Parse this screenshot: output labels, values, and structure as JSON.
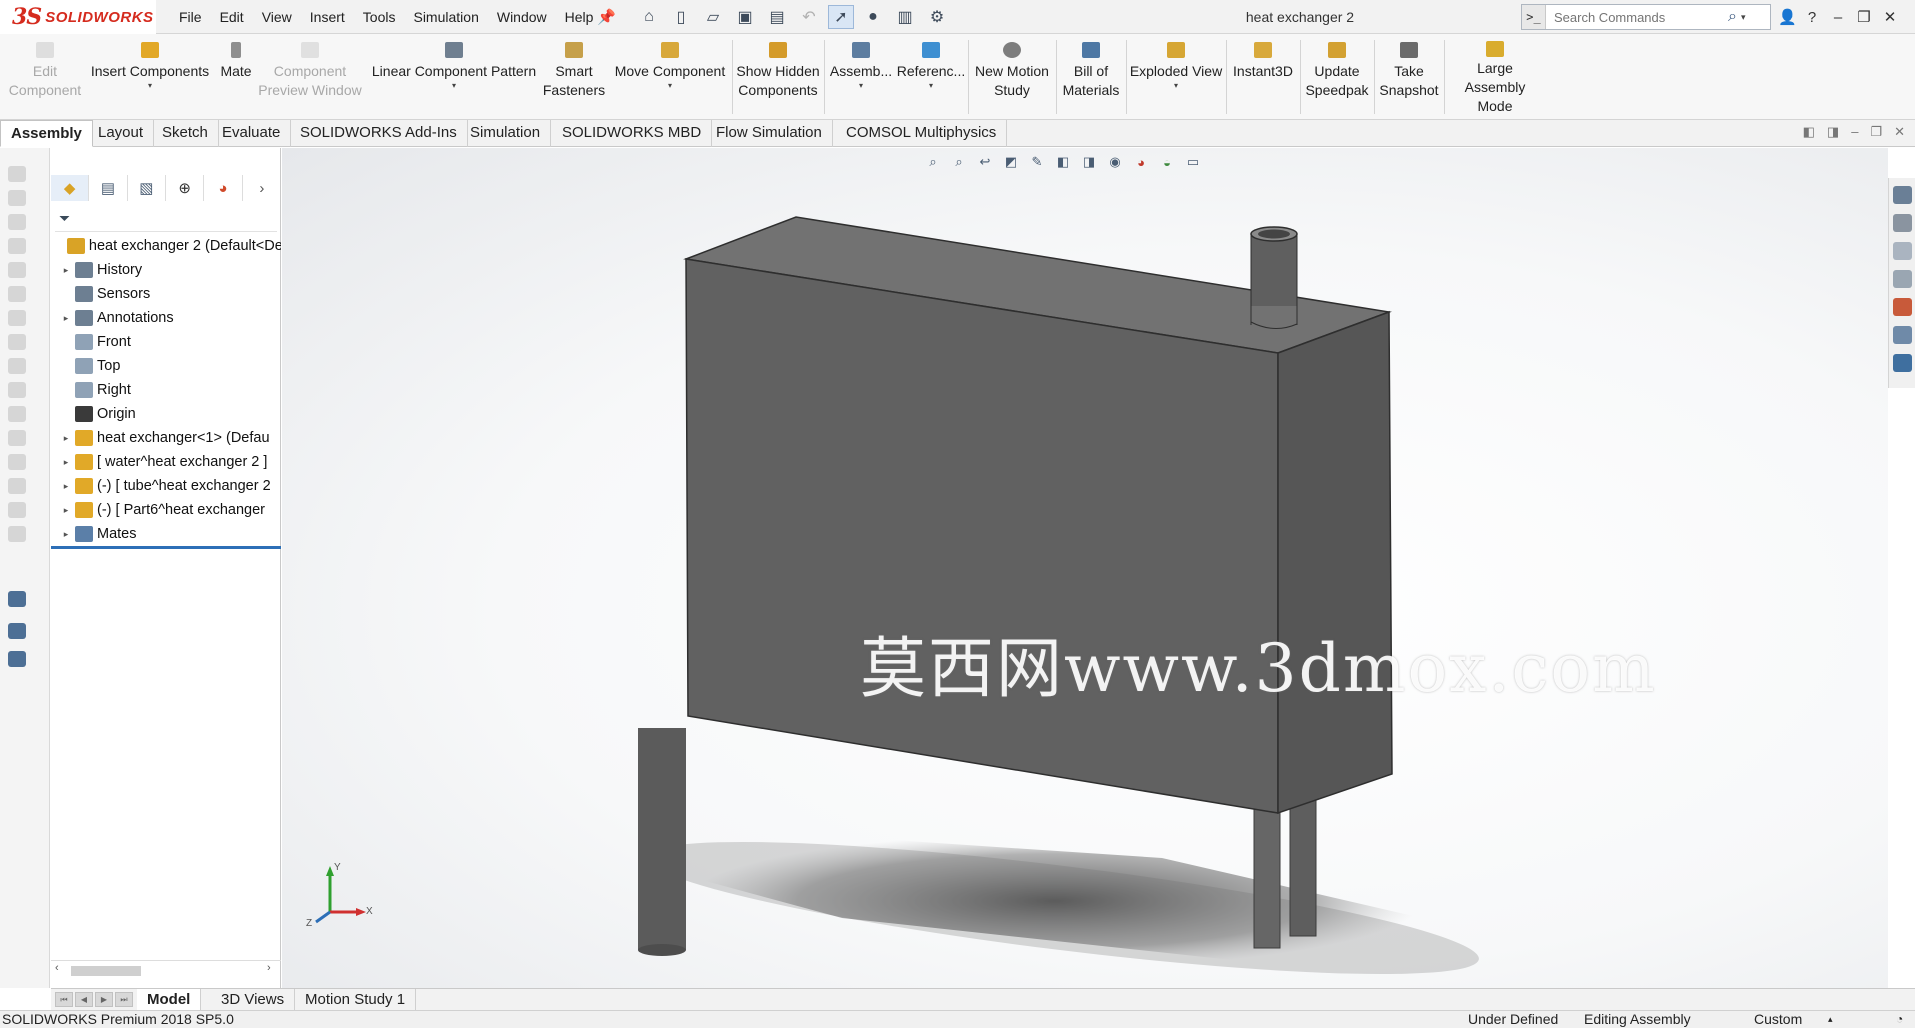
{
  "app": {
    "brand_ds": "3S",
    "brand_name": "SOLIDWORKS",
    "document_title": "heat exchanger 2"
  },
  "menu": [
    "File",
    "Edit",
    "View",
    "Insert",
    "Tools",
    "Simulation",
    "Window",
    "Help"
  ],
  "search": {
    "placeholder": "Search Commands"
  },
  "commands": {
    "edit_component": "Edit\nComponent",
    "insert_components": "Insert Components",
    "mate": "Mate",
    "component_preview": "Component\nPreview Window",
    "linear_pattern": "Linear Component Pattern",
    "smart_fasteners": "Smart\nFasteners",
    "move_component": "Move Component",
    "show_hidden": "Show Hidden\nComponents",
    "assembly": "Assemb...",
    "reference": "Referenc...",
    "new_motion_study": "New Motion\nStudy",
    "bill_of_materials": "Bill of\nMaterials",
    "exploded_view": "Exploded View",
    "instant3d": "Instant3D",
    "update_speedpak": "Update\nSpeedpak",
    "take_snapshot": "Take\nSnapshot",
    "large_assembly_mode": "Large Assembly\nMode"
  },
  "tabs": [
    "Assembly",
    "Layout",
    "Sketch",
    "Evaluate",
    "SOLIDWORKS Add-Ins",
    "Simulation",
    "SOLIDWORKS MBD",
    "Flow Simulation",
    "COMSOL Multiphysics"
  ],
  "tree": {
    "items": [
      {
        "label": "heat exchanger 2  (Default<De",
        "icon_color": "#d9a326",
        "expand": ""
      },
      {
        "label": "History",
        "icon_color": "#6d7f92",
        "expand": "▸"
      },
      {
        "label": "Sensors",
        "icon_color": "#6d7f92",
        "expand": ""
      },
      {
        "label": "Annotations",
        "icon_color": "#6d7f92",
        "expand": "▸"
      },
      {
        "label": "Front",
        "icon_color": "#8fa2b6",
        "expand": ""
      },
      {
        "label": "Top",
        "icon_color": "#8fa2b6",
        "expand": ""
      },
      {
        "label": "Right",
        "icon_color": "#8fa2b6",
        "expand": ""
      },
      {
        "label": "Origin",
        "icon_color": "#3a3a3a",
        "expand": ""
      },
      {
        "label": "heat exchanger<1> (Defau",
        "icon_color": "#e1a928",
        "expand": "▸"
      },
      {
        "label": "[ water^heat exchanger 2 ]",
        "icon_color": "#e1a928",
        "expand": "▸"
      },
      {
        "label": "(-) [ tube^heat exchanger 2",
        "icon_color": "#e1a928",
        "expand": "▸"
      },
      {
        "label": "(-) [ Part6^heat exchanger",
        "icon_color": "#e1a928",
        "expand": "▸"
      },
      {
        "label": "Mates",
        "icon_color": "#5b7fa8",
        "expand": "▸"
      }
    ]
  },
  "viewport": {
    "watermark": "莫西网www.3dmox.com",
    "triad_x": "X",
    "triad_y": "Y",
    "triad_z": "Z"
  },
  "bottom_tabs": [
    "Model",
    "3D Views",
    "Motion Study 1"
  ],
  "status": {
    "product": "SOLIDWORKS Premium 2018 SP5.0",
    "definition": "Under Defined",
    "mode": "Editing Assembly",
    "units": "Custom"
  },
  "colors": {
    "brand_red": "#d52b1e",
    "accent_blue": "#2d6fb7",
    "model_front": "#616161",
    "model_top": "#727272",
    "model_side": "#565656"
  }
}
